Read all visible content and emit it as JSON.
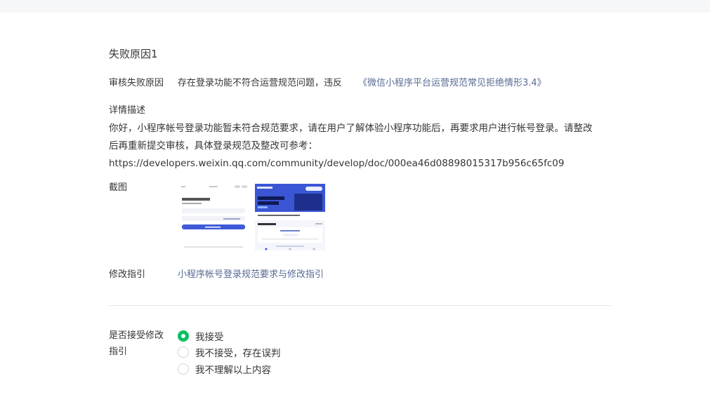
{
  "section_title": "失败原因1",
  "reason": {
    "label": "审核失败原因",
    "text": "存在登录功能不符合运营规范问题，违反",
    "link": "《微信小程序平台运营规范常见拒绝情形3.4》"
  },
  "detail": {
    "label": "详情描述",
    "line1": "你好，小程序帐号登录功能暂未符合规范要求，请在用户了解体验小程序功能后，再要求用户进行帐号登录。请整改",
    "line2": "后再重新提交审核，具体登录规范及整改可参考：",
    "url": "https://developers.weixin.qq.com/community/develop/doc/000ea46d08898015317b956c65fc09"
  },
  "screenshots": {
    "label": "截图",
    "count": 2
  },
  "guide": {
    "label": "修改指引",
    "link": "小程序帐号登录规范要求与修改指引"
  },
  "accept": {
    "label_line1": "是否接受修改",
    "label_line2": "指引",
    "options": [
      {
        "label": "我接受",
        "checked": true
      },
      {
        "label": "我不接受，存在误判",
        "checked": false
      },
      {
        "label": "我不理解以上内容",
        "checked": false
      }
    ]
  },
  "colors": {
    "link": "#576b95",
    "radio_checked": "#07c160",
    "text": "#353535"
  }
}
